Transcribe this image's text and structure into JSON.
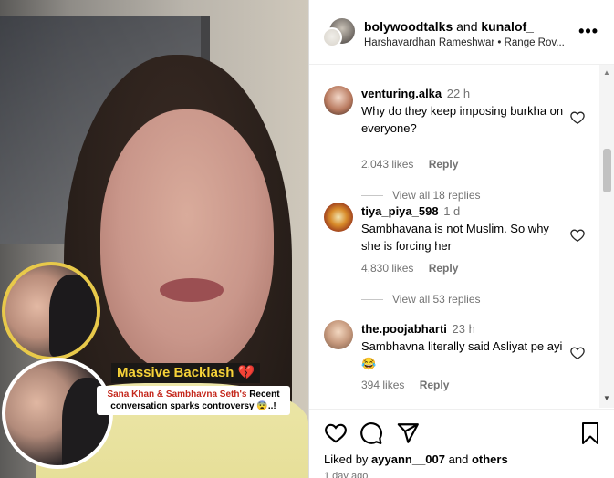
{
  "post": {
    "author": "bolywoodtalks",
    "conjunction": "and",
    "coauthor": "kunalof_",
    "subtitle": "Harshavardhan Rameshwar • Range Rov...",
    "more": "•••"
  },
  "media": {
    "headline": "Massive Backlash 💔",
    "sub_highlight": "Sana Khan & Sambhavna Seth's",
    "sub_rest": "Recent conversation sparks controversy 😨..!"
  },
  "comments": [
    {
      "user": "venturing.alka",
      "time": "22 h",
      "text": "Why do they keep imposing burkha on everyone?",
      "likes": "2,043 likes",
      "reply": "Reply",
      "view_replies": "View all 18 replies"
    },
    {
      "user": "tiya_piya_598",
      "time": "1 d",
      "text": "Sambhavana is not Muslim. So why she is forcing her",
      "likes": "4,830 likes",
      "reply": "Reply",
      "view_replies": "View all 53 replies"
    },
    {
      "user": "the.poojabharti",
      "time": "23 h",
      "text": "Sambhavna literally said Asliyat pe ayi😂",
      "likes": "394 likes",
      "reply": "Reply"
    }
  ],
  "footer": {
    "liked_prefix": "Liked by",
    "liked_user": "ayyann__007",
    "liked_and": "and",
    "liked_others": "others",
    "date": "1 day ago"
  },
  "icons": {
    "like": "heart-outline-icon",
    "comment": "speech-bubble-icon",
    "share": "paper-plane-icon",
    "save": "bookmark-icon"
  },
  "colors": {
    "headline_bg": "#1a1816",
    "headline_text": "#f6d238",
    "highlight": "#c4281c"
  }
}
